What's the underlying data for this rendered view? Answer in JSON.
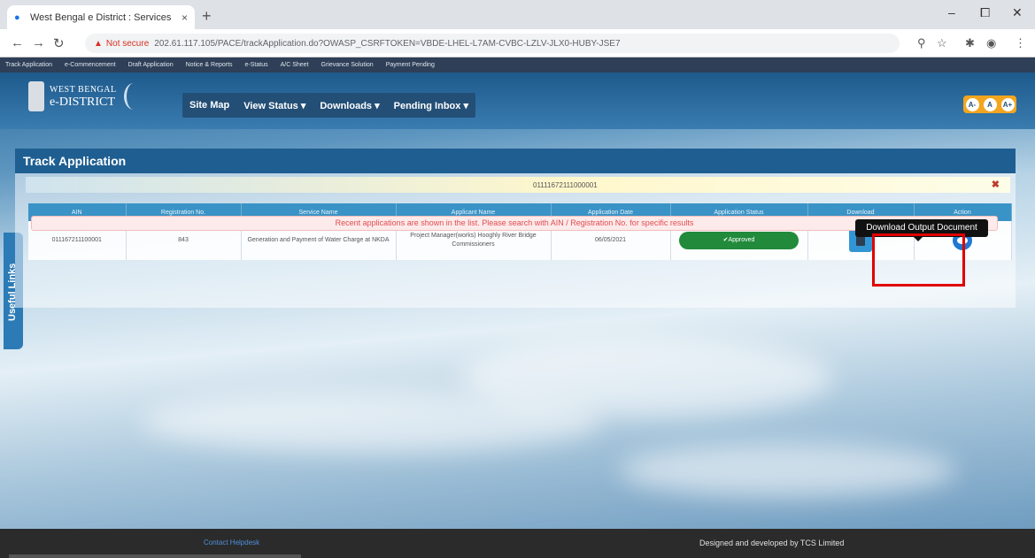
{
  "browser": {
    "tab_title": "West Bengal e District : Services",
    "tab_close": "×",
    "new_tab": "+",
    "url_warning": "Not secure",
    "url": "202.61.117.105/PACE/trackApplication.do?OWASP_CSRFTOKEN=VBDE-LHEL-L7AM-CVBC-LZLV-JLX0-HUBY-JSE7",
    "win_min": "–",
    "win_max": "⧠",
    "win_close": "✕"
  },
  "bookmarks": [
    "Track Application",
    "e-Commencement",
    "Draft Application",
    "Notice & Reports",
    "e-Status",
    "A/C Sheet",
    "Grievance Solution",
    "Payment Pending"
  ],
  "header": {
    "logo_line1": "WEST BENGAL",
    "logo_line2": "e-DISTRICT",
    "menu": [
      "Site Map",
      "View Status ▾",
      "Downloads ▾",
      "Pending Inbox ▾"
    ],
    "font_buttons": [
      "A-",
      "A",
      "A+"
    ]
  },
  "sidebar_tab": "Useful Links",
  "panel": {
    "title": "Track Application",
    "search_value": "01111672111000001",
    "search_clear": "✖"
  },
  "table": {
    "columns": [
      "AIN",
      "Registration No.",
      "Service Name",
      "Applicant Name",
      "Application Date",
      "Application Status",
      "Download",
      "Action"
    ],
    "row": {
      "ain": "011167211100001",
      "reg_no": "843",
      "service": "Generation and Payment of Water Charge at NKDA",
      "applicant": "Project Manager(works) Hooghly River Bridge Commissioners",
      "date": "06/05/2021",
      "status": "✔Approved"
    }
  },
  "notice": "Recent applications are shown in the list. Please search with AIN / Registration No. for specific results",
  "tooltip": "Download Output Document",
  "footer": {
    "left": "Contact Helpdesk",
    "right": "Designed and developed by TCS Limited"
  }
}
